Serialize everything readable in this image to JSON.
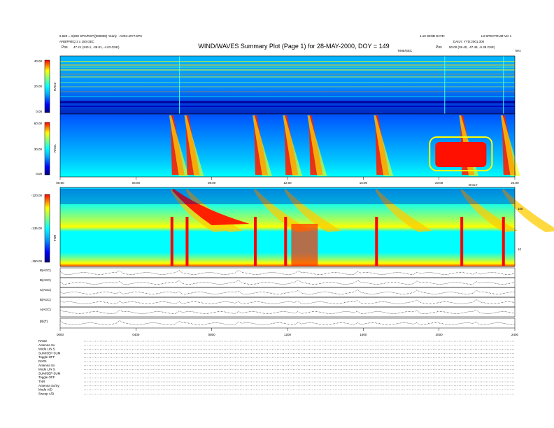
{
  "header": {
    "title": "WIND/WAVES Summary Plot (Page 1) for 28-MAY-2000, DOY = 149",
    "left_line1": "6.520 = 3(200 SPC/RSP)(000000) Yearly - AVEC.MYT.SPC",
    "left_line2": "ARB/FREQ 3 x 150 DEC",
    "pos_left_label": "Pos",
    "pos_left_value": "47.21 (240.1, -38.81, -4.03 GSE)",
    "right_line1": "1.10 WIND DATE:",
    "right_line2": "DAILY: YYD:2001.300",
    "pos_right_label": "Pos",
    "pos_right_value": "50.00 (38.40, -47.48, -5.39 GSE)",
    "corner_right": "L3 SPECTRUM Ver 1",
    "timestep_label": "TIME/SEC",
    "hz_label": "kHz",
    "daily_label": "DAILY"
  },
  "panels": {
    "rad2": {
      "ylabel": "RAD2",
      "ticks": [
        "40.00",
        "20.00",
        "0.00"
      ]
    },
    "rad1": {
      "ylabel": "RAD1",
      "ticks": [
        "60.00",
        "30.00",
        "0.00"
      ]
    },
    "tnr": {
      "ylabel": "TNR",
      "ticks": [
        "-120.00",
        "-135.00",
        "-150.00"
      ],
      "right_ticks": [
        "100",
        "10"
      ]
    }
  },
  "time_axis": {
    "ticks": [
      "00:00",
      "04:00",
      "08:00",
      "12:00",
      "16:00",
      "20:00",
      "24:00"
    ],
    "bottom_ticks": [
      "0000",
      "0400",
      "0800",
      "1200",
      "1600",
      "2000",
      "2400"
    ]
  },
  "param_panels": {
    "labels": [
      "B(AGC)",
      "B(AGC)",
      "C(AGC)",
      "B(AGC)",
      "A(AGC)",
      "|B|(T)"
    ]
  },
  "info_block": {
    "lines": [
      "RAD2",
      "Antenna   Sx",
      "Mode   LIN S",
      "SUM/SEP SUM",
      "Toggle   OFF",
      "RAD1",
      "Antenna   Sx",
      "Mode   LIN S",
      "SUM/SEP SUM",
      "Toggle   OFF",
      "TNR",
      "Antenna   Sx/Sy",
      "Mode   A/D",
      "Sweep   A/D"
    ]
  },
  "chart_data": [
    {
      "type": "heatmap",
      "title": "WIND/WAVES Summary Plot (Page 1) for 28-MAY-2000, DOY = 149",
      "panel": "RAD2",
      "x": [
        "00:00",
        "04:00",
        "08:00",
        "12:00",
        "16:00",
        "20:00",
        "24:00"
      ],
      "xlim": [
        0,
        24
      ],
      "ylabel": "RAD2",
      "colorbar_ticks": [
        40.0,
        20.0,
        0.0
      ],
      "colorbar_range": [
        0,
        40
      ],
      "colors": [
        "#000080",
        "#0000ff",
        "#00aaff",
        "#00ffff",
        "#80ff80",
        "#ffff00",
        "#ff8000",
        "#ff0000"
      ]
    },
    {
      "type": "heatmap",
      "panel": "RAD1",
      "x": [
        "00:00",
        "04:00",
        "08:00",
        "12:00",
        "16:00",
        "20:00",
        "24:00"
      ],
      "xlim": [
        0,
        24
      ],
      "ylabel": "RAD1",
      "colorbar_ticks": [
        60.0,
        30.0,
        0.0
      ],
      "colorbar_range": [
        0,
        60
      ],
      "bursts_hours": [
        5.9,
        6.7,
        10.3,
        11.9,
        13.2,
        16.7,
        21.2,
        23.4
      ],
      "storm_hours": [
        19.8,
        22.5
      ],
      "colors": [
        "#000080",
        "#0000ff",
        "#00aaff",
        "#00ffff",
        "#80ff80",
        "#ffff00",
        "#ff8000",
        "#ff0000"
      ]
    },
    {
      "type": "heatmap",
      "panel": "TNR",
      "x": [
        "00:00",
        "04:00",
        "08:00",
        "12:00",
        "16:00",
        "20:00",
        "24:00"
      ],
      "xlim": [
        0,
        24
      ],
      "ylabel": "TNR",
      "colorbar_ticks": [
        -120.0,
        -135.0,
        -150.0
      ],
      "colorbar_range": [
        -150,
        -120
      ],
      "right_axis_ticks": [
        100,
        10
      ],
      "bursts_hours": [
        5.9,
        6.7,
        10.3,
        11.9,
        16.7,
        21.2,
        23.4
      ],
      "colors": [
        "#000080",
        "#0000ff",
        "#00aaff",
        "#00ffff",
        "#80ff80",
        "#ffff00",
        "#ff8000",
        "#ff0000"
      ]
    }
  ]
}
